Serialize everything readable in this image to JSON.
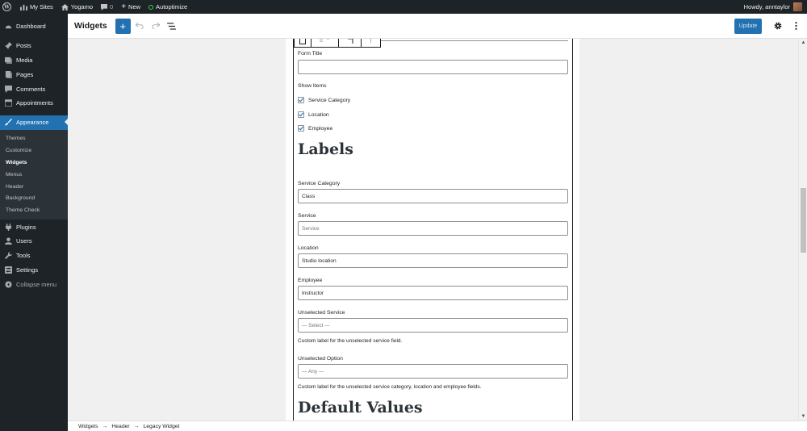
{
  "adminbar": {
    "my_sites": "My Sites",
    "site_name": "Yogamo",
    "comments_count": "0",
    "new_label": "New",
    "plugin_label": "Autoptimize",
    "howdy": "Howdy, anntaylor"
  },
  "sidebar": {
    "items": [
      {
        "label": "Dashboard",
        "icon": "dashboard-icon"
      },
      {
        "label": "Posts",
        "icon": "pin-icon"
      },
      {
        "label": "Media",
        "icon": "media-icon"
      },
      {
        "label": "Pages",
        "icon": "pages-icon"
      },
      {
        "label": "Comments",
        "icon": "comment-icon"
      },
      {
        "label": "Appointments",
        "icon": "calendar-icon"
      },
      {
        "label": "Appearance",
        "icon": "brush-icon"
      }
    ],
    "appearance_sub": [
      "Themes",
      "Customize",
      "Widgets",
      "Menus",
      "Header",
      "Background",
      "Theme Check"
    ],
    "items_after": [
      {
        "label": "Plugins",
        "icon": "plugin-icon"
      },
      {
        "label": "Users",
        "icon": "users-icon"
      },
      {
        "label": "Tools",
        "icon": "wrench-icon"
      },
      {
        "label": "Settings",
        "icon": "settings-icon"
      }
    ],
    "collapse_label": "Collapse menu"
  },
  "header": {
    "title": "Widgets",
    "update_label": "Update"
  },
  "form": {
    "form_title_label": "Form Title",
    "form_title_value": "",
    "show_items_label": "Show Items",
    "show_items": [
      "Service Category",
      "Location",
      "Employee"
    ],
    "labels_heading": "Labels",
    "service_category_label": "Service Category",
    "service_category_value": "Class",
    "service_label": "Service",
    "service_placeholder": "Service",
    "location_label": "Location",
    "location_value": "Studio location",
    "employee_label": "Employee",
    "employee_value": "Instructor",
    "unselected_service_label": "Unselected Service",
    "unselected_service_placeholder": "— Select —",
    "unselected_service_help": "Custom label for the unselected service field.",
    "unselected_option_label": "Unselected Option",
    "unselected_option_placeholder": "— Any —",
    "unselected_option_help": "Custom label for the unselected service category, location and employee fields.",
    "default_values_heading": "Default Values"
  },
  "breadcrumb": [
    "Widgets",
    "Header",
    "Legacy Widget"
  ],
  "breadcrumb_separator": "→",
  "colors": {
    "admin_dark": "#1d2327",
    "accent": "#2271b1",
    "canvas_bg": "#f0f0f1"
  }
}
